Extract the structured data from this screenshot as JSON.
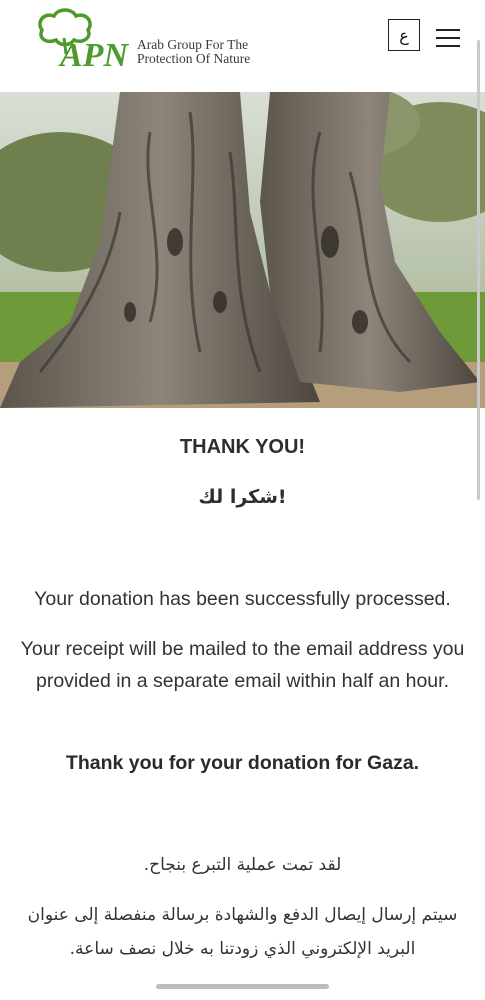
{
  "header": {
    "logo_text": "APN",
    "org_name_line1": "Arab Group For The",
    "org_name_line2": "Protection Of Nature",
    "lang_toggle": "ع",
    "menu_icon": "hamburger-menu-icon"
  },
  "hero": {
    "alt": "old olive tree trunks"
  },
  "content": {
    "thank_you_en": "THANK YOU!",
    "thank_you_ar": "شكرا لك!",
    "processed": "Your donation has been successfully processed.",
    "receipt": "Your receipt will be mailed to the email address you provided in a separate email within half an hour.",
    "gaza": "Thank you for your donation for Gaza.",
    "ar_processed": "لقد تمت عملية التبرع بنجاح.",
    "ar_receipt": "سيتم إرسال إيصال الدفع والشهادة برسالة منفصلة إلى عنوان البريد الإلكتروني الذي زودتنا به خلال نصف ساعة."
  },
  "colors": {
    "brand_green": "#4e9a2f",
    "text": "#333333"
  }
}
